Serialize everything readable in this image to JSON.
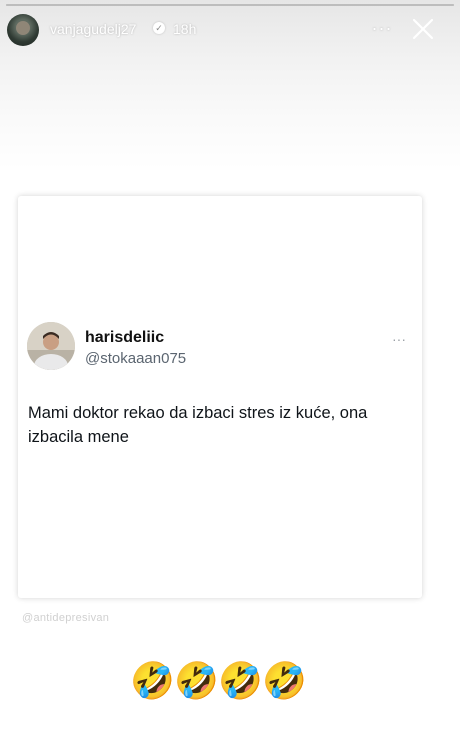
{
  "story": {
    "username": "vanjagudelj27",
    "time": "18h",
    "more_label": "···",
    "icons": {
      "verified": "verified-badge-icon",
      "close": "close-icon",
      "more": "more-icon"
    }
  },
  "tweet": {
    "display_name": "harisdeliic",
    "handle": "@stokaaan075",
    "more_label": "···",
    "text": "Mami doktor rekao da izbaci stres iz kuće, ona izbacila mene"
  },
  "watermark": "@antidepresivan",
  "reactions": [
    "🤣",
    "🤣",
    "🤣",
    "🤣"
  ],
  "colors": {
    "text": "#0f1419",
    "handle": "#5b6570",
    "overlay_text": "#ffffff"
  }
}
